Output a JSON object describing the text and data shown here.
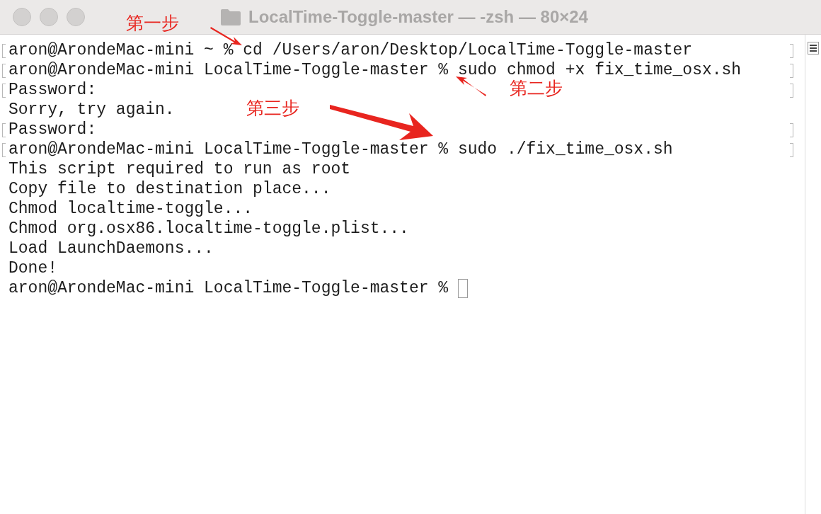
{
  "window": {
    "title": "LocalTime-Toggle-master — -zsh — 80×24"
  },
  "terminal": {
    "lines": [
      {
        "text": "aron@ArondeMac-mini ~ % cd /Users/aron/Desktop/LocalTime-Toggle-master",
        "marked": true,
        "cursor": false
      },
      {
        "text": "aron@ArondeMac-mini LocalTime-Toggle-master % sudo chmod +x fix_time_osx.sh",
        "marked": true,
        "cursor": false
      },
      {
        "text": "Password:",
        "marked": true,
        "cursor": false
      },
      {
        "text": "Sorry, try again.",
        "marked": false,
        "cursor": false
      },
      {
        "text": "Password:",
        "marked": true,
        "cursor": false
      },
      {
        "text": "aron@ArondeMac-mini LocalTime-Toggle-master % sudo ./fix_time_osx.sh",
        "marked": true,
        "cursor": false
      },
      {
        "text": "This script required to run as root",
        "marked": false,
        "cursor": false
      },
      {
        "text": "Copy file to destination place...",
        "marked": false,
        "cursor": false
      },
      {
        "text": "Chmod localtime-toggle...",
        "marked": false,
        "cursor": false
      },
      {
        "text": "Chmod org.osx86.localtime-toggle.plist...",
        "marked": false,
        "cursor": false
      },
      {
        "text": "Load LaunchDaemons...",
        "marked": false,
        "cursor": false
      },
      {
        "text": "Done!",
        "marked": false,
        "cursor": false
      },
      {
        "text": "aron@ArondeMac-mini LocalTime-Toggle-master %",
        "marked": false,
        "cursor": true
      }
    ]
  },
  "annotations": [
    {
      "label": "第一步"
    },
    {
      "label": "第二步"
    },
    {
      "label": "第三步"
    }
  ]
}
